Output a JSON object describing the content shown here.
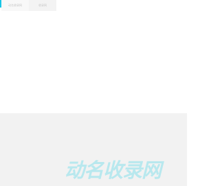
{
  "tabs": [
    {
      "label": "动名收录网"
    },
    {
      "label": "收录网"
    }
  ],
  "branding": {
    "logo_text": "动名收录网"
  },
  "colors": {
    "accent": "#18c6e6",
    "logo": "#b8e8ee",
    "footer_bg": "#f2f2f2"
  }
}
